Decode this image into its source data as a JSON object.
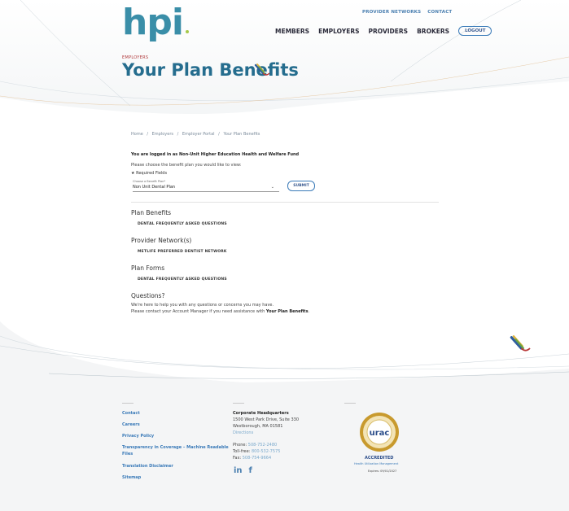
{
  "header": {
    "logo_text": "hpi",
    "top_links": [
      "PROVIDER NETWORKS",
      "CONTACT"
    ],
    "nav_items": [
      "MEMBERS",
      "EMPLOYERS",
      "PROVIDERS",
      "BROKERS"
    ],
    "logout_label": "LOGOUT",
    "eyebrow": "EMPLOYERS",
    "page_title": "Your Plan Benefits"
  },
  "breadcrumb": [
    "Home",
    "/",
    "Employers",
    "/",
    "Employer Portal",
    "/",
    "Your Plan Benefits"
  ],
  "main": {
    "login_note": "You are logged in as Non-Unit Higher Education Health and Welfare Fund",
    "choose_text": "Please choose the benefit plan you would like to view:",
    "required_text": "★ Required Fields",
    "select_label": "Choose a Benefit Plan*",
    "select_value": "Non Unit Dental Plan",
    "submit_label": "SUBMIT",
    "sections": [
      {
        "heading": "Plan Benefits",
        "link": "DENTAL FREQUENTLY ASKED QUESTIONS"
      },
      {
        "heading": "Provider Network(s)",
        "link": "METLIFE PREFERRED DENTIST NETWORK"
      },
      {
        "heading": "Plan Forms",
        "link": "DENTAL FREQUENTLY ASKED QUESTIONS"
      }
    ],
    "questions_heading": "Questions?",
    "questions_line1": "We're here to help you with any questions or concerns you may have.",
    "questions_line2_pre": "Please contact your Account Manager if you need assistance with ",
    "questions_line2_bold": "Your Plan Benefits",
    "questions_line2_post": "."
  },
  "footer": {
    "links": [
      "Contact",
      "Careers",
      "Privacy Policy",
      "Transparency in Coverage – Machine Readable",
      "Files",
      "Translation Disclaimer",
      "Sitemap"
    ],
    "hq_title": "Corporate Headquarters",
    "hq_address1": "1500 West Park Drive, Suite 330",
    "hq_address2": "Westborough, MA 01581",
    "hq_directions": "Directions",
    "phone_label": "Phone: ",
    "phone": "508-752-2480",
    "tollfree_label": "Toll-free: ",
    "tollfree": "800-532-7575",
    "fax_label": "Fax: ",
    "fax": "508-754-9664",
    "social": [
      "in",
      "f"
    ],
    "urac_text": "urac",
    "accredited": "ACCREDITED",
    "accredited_sub": "Health Utilization Management",
    "expires": "Expires: 09/01/2027"
  },
  "colors": {
    "brand": "#3a8ea8",
    "title": "#256d8e",
    "link": "#3a7ab8",
    "eyebrow": "#b0383a"
  }
}
